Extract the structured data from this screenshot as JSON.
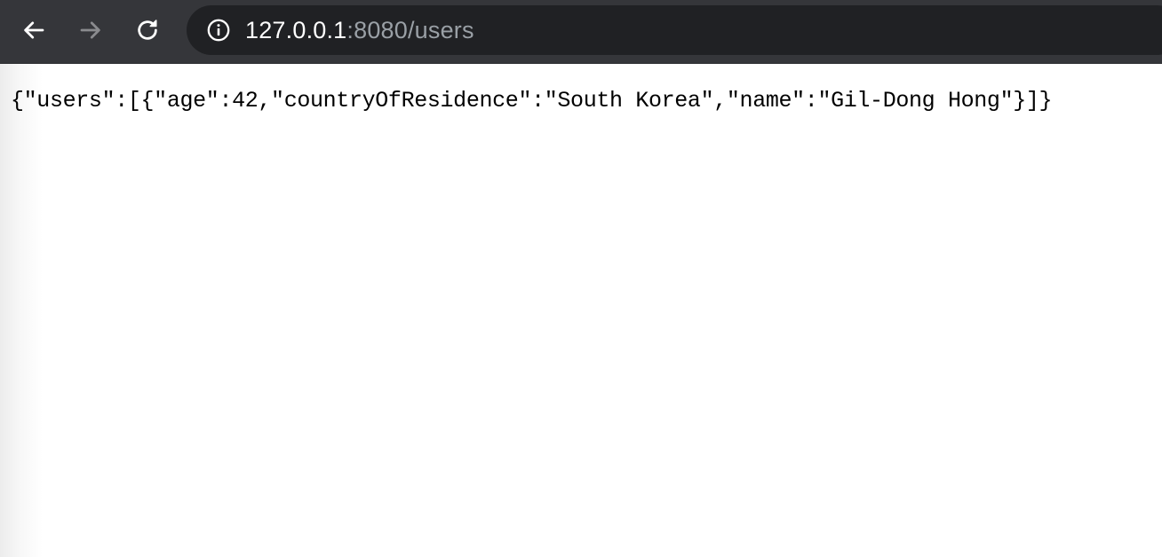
{
  "browser": {
    "address_bar": {
      "host": "127.0.0.1",
      "path": ":8080/users"
    },
    "icons": {
      "back": "arrow-left-icon",
      "forward": "arrow-right-icon",
      "reload": "reload-icon",
      "site_info": "info-icon"
    },
    "colors": {
      "toolbar_bg": "#35363a",
      "omnibox_bg": "#202124",
      "host_text": "#ffffff",
      "path_text": "#9aa0a6"
    }
  },
  "page": {
    "body_text": "{\"users\":[{\"age\":42,\"countryOfResidence\":\"South Korea\",\"name\":\"Gil-Dong Hong\"}]}"
  }
}
